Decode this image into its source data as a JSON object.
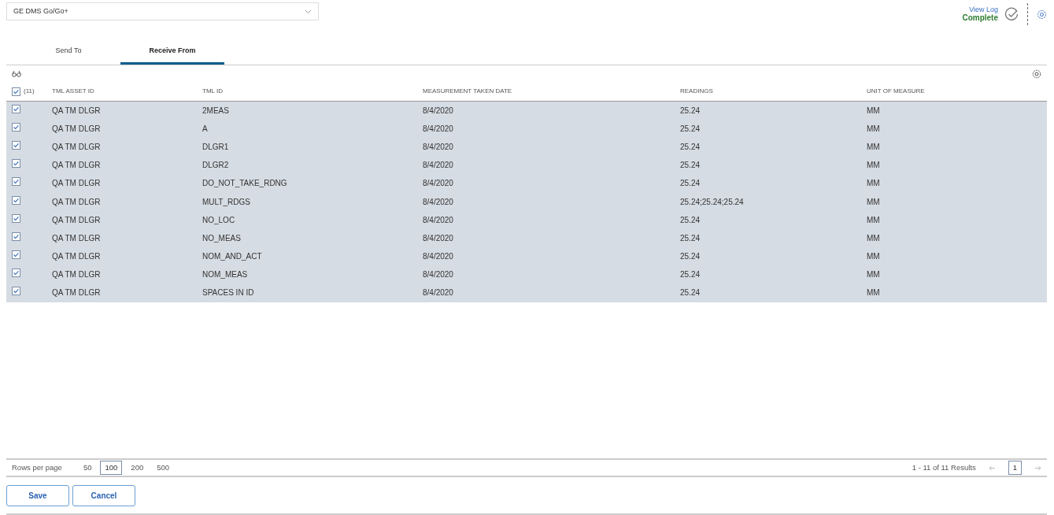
{
  "source_select": {
    "value": "GE DMS Go/Go+"
  },
  "status": {
    "view_log": "View Log",
    "state": "Complete"
  },
  "tabs": [
    {
      "label": "Send To",
      "selected": false
    },
    {
      "label": "Receive From",
      "selected": true
    }
  ],
  "table": {
    "select_all": {
      "checked": true,
      "count": "(11)"
    },
    "columns": [
      "TML ASSET ID",
      "TML ID",
      "MEASUREMENT TAKEN DATE",
      "READINGS",
      "UNIT OF MEASURE"
    ],
    "rows": [
      {
        "checked": true,
        "cells": [
          "QA TM DLGR",
          "2MEAS",
          "8/4/2020",
          "25.24",
          "MM"
        ]
      },
      {
        "checked": true,
        "cells": [
          "QA TM DLGR",
          "A",
          "8/4/2020",
          "25.24",
          "MM"
        ]
      },
      {
        "checked": true,
        "cells": [
          "QA TM DLGR",
          "DLGR1",
          "8/4/2020",
          "25.24",
          "MM"
        ]
      },
      {
        "checked": true,
        "cells": [
          "QA TM DLGR",
          "DLGR2",
          "8/4/2020",
          "25.24",
          "MM"
        ]
      },
      {
        "checked": true,
        "cells": [
          "QA TM DLGR",
          "DO_NOT_TAKE_RDNG",
          "8/4/2020",
          "25.24",
          "MM"
        ]
      },
      {
        "checked": true,
        "cells": [
          "QA TM DLGR",
          "MULT_RDGS",
          "8/4/2020",
          "25.24;25.24;25.24",
          "MM"
        ]
      },
      {
        "checked": true,
        "cells": [
          "QA TM DLGR",
          "NO_LOC",
          "8/4/2020",
          "25.24",
          "MM"
        ]
      },
      {
        "checked": true,
        "cells": [
          "QA TM DLGR",
          "NO_MEAS",
          "8/4/2020",
          "25.24",
          "MM"
        ]
      },
      {
        "checked": true,
        "cells": [
          "QA TM DLGR",
          "NOM_AND_ACT",
          "8/4/2020",
          "25.24",
          "MM"
        ]
      },
      {
        "checked": true,
        "cells": [
          "QA TM DLGR",
          "NOM_MEAS",
          "8/4/2020",
          "25.24",
          "MM"
        ]
      },
      {
        "checked": true,
        "cells": [
          "QA TM DLGR",
          "SPACES IN ID",
          "8/4/2020",
          "25.24",
          "MM"
        ]
      }
    ]
  },
  "pagination": {
    "rows_label": "Rows per page",
    "sizes": [
      {
        "label": "50",
        "selected": false
      },
      {
        "label": "100",
        "selected": true
      },
      {
        "label": "200",
        "selected": false
      },
      {
        "label": "500",
        "selected": false
      }
    ],
    "results": "1 - 11 of 11 Results",
    "page": "1"
  },
  "buttons": [
    "Save",
    "Cancel"
  ]
}
